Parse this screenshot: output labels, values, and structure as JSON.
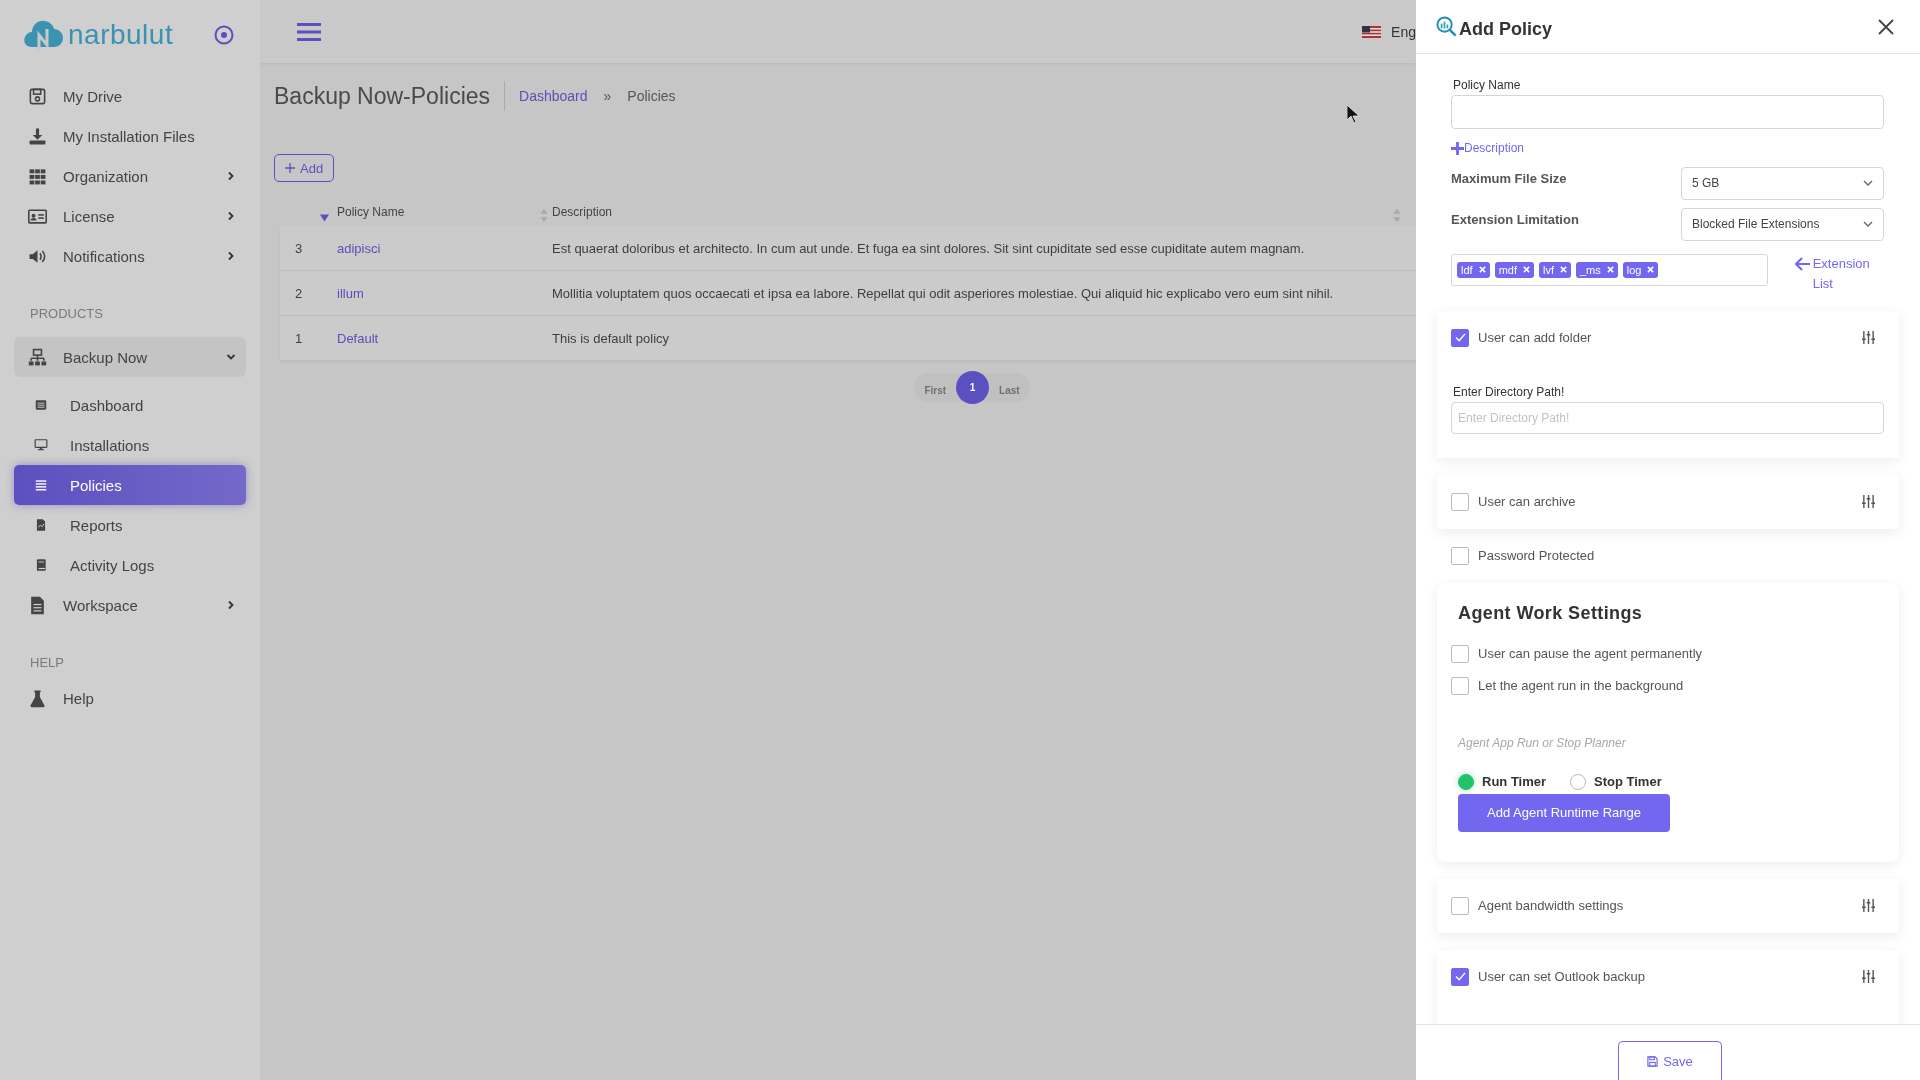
{
  "logo": {
    "text": "narbulut"
  },
  "sidebar": {
    "items": [
      {
        "kind": "link",
        "label": "My Drive",
        "selected": false
      },
      {
        "kind": "link",
        "label": "My Installation Files",
        "selected": false
      },
      {
        "kind": "link",
        "label": "Organization",
        "selected": false,
        "expanded": false
      },
      {
        "kind": "link",
        "label": "License",
        "selected": false,
        "expanded": false
      },
      {
        "kind": "link",
        "label": "Notifications",
        "selected": false,
        "expanded": false
      },
      {
        "kind": "heading",
        "label": "PRODUCTS"
      },
      {
        "kind": "link",
        "label": "Backup Now",
        "selected": false,
        "expanded": true,
        "children": [
          {
            "label": "Dashboard",
            "selected": false
          },
          {
            "label": "Installations",
            "selected": false
          },
          {
            "label": "Policies",
            "selected": true
          },
          {
            "label": "Reports",
            "selected": false
          },
          {
            "label": "Activity Logs",
            "selected": false
          }
        ]
      },
      {
        "kind": "link",
        "label": "Workspace",
        "selected": false,
        "expanded": false
      },
      {
        "kind": "heading",
        "label": "HELP"
      },
      {
        "kind": "link",
        "label": "Help",
        "selected": false
      }
    ]
  },
  "header": {
    "language": "Eng"
  },
  "page": {
    "title": "Backup Now-Policies",
    "breadcrumb": [
      {
        "label": "Dashboard",
        "kind": "link"
      },
      {
        "label": "»",
        "kind": "separator"
      },
      {
        "label": "Policies",
        "kind": "current"
      }
    ],
    "add_button": "Add"
  },
  "table": {
    "columns": [
      {
        "sorted": true
      },
      {
        "label": "Policy Name",
        "sorted": false
      },
      {
        "label": "Description",
        "sorted": false
      }
    ],
    "rows": [
      [
        "3",
        "adipisci",
        "Est quaerat doloribus et architecto. In cum aut unde. Et fuga ea sint dolores. Sit sint cupiditate sed esse cupiditate autem magnam."
      ],
      [
        "2",
        "illum",
        "Mollitia voluptatem quos occaecati et ipsa ea labore. Repellat qui odit asperiores molestiae. Qui aliquid hic explicabo vero eum sint nihil."
      ],
      [
        "1",
        "Default",
        "This is default policy"
      ]
    ]
  },
  "pagination": [
    {
      "label": "First",
      "kind": "nav",
      "selected": false
    },
    {
      "label": "1",
      "kind": "page",
      "selected": true
    },
    {
      "label": "Last",
      "kind": "nav",
      "selected": false
    }
  ],
  "drawer": {
    "title": "Add Policy",
    "policy_name": {
      "label": "Policy Name"
    },
    "description_link": "Description",
    "max_file_size": {
      "label": "Maximum File Size",
      "value": "5 GB"
    },
    "extension_limitation": {
      "label": "Extension Limitation",
      "value": "Blocked File Extensions"
    },
    "extensions": [
      "ldf",
      "mdf",
      "lvf",
      "_ms",
      "log"
    ],
    "extension_list_link": "Extension List",
    "options": [
      {
        "kind": "card",
        "label": "User can add folder",
        "checked": true,
        "field": {
          "label": "Enter Directory Path!",
          "placeholder": "Enter Directory Path!"
        }
      },
      {
        "kind": "card",
        "label": "User can archive",
        "checked": false
      },
      {
        "kind": "plain",
        "label": "Password Protected",
        "checked": false
      },
      {
        "kind": "agent",
        "title": "Agent Work Settings",
        "checks": [
          {
            "label": "User can pause the agent permanently",
            "checked": false
          },
          {
            "label": "Let the agent run in the background",
            "checked": false
          }
        ],
        "planner_hint": "Agent App Run or Stop Planner",
        "timers": [
          {
            "label": "Run Timer",
            "selected": true
          },
          {
            "label": "Stop Timer",
            "selected": false
          }
        ],
        "button": "Add Agent Runtime Range"
      },
      {
        "kind": "card",
        "label": "Agent bandwidth settings",
        "checked": false
      },
      {
        "kind": "card",
        "label": "User can set Outlook backup",
        "checked": true
      }
    ],
    "save_button": "Save"
  }
}
